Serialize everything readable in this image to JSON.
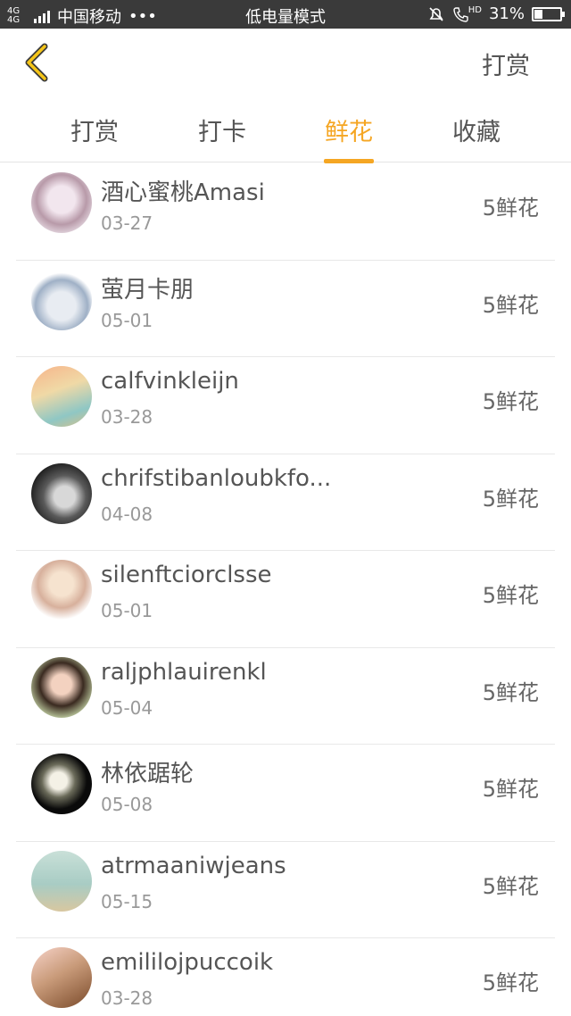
{
  "status_bar": {
    "network": "4G 4G",
    "carrier": "中国移动",
    "dots": "•••",
    "mode": "低电量模式",
    "hd_label": "HD",
    "battery": "31%",
    "battery_level": 0.31
  },
  "header": {
    "action_label": "打赏"
  },
  "tabs": [
    {
      "label": "打赏"
    },
    {
      "label": "打卡"
    },
    {
      "label": "鲜花",
      "active": true
    },
    {
      "label": "收藏"
    }
  ],
  "list": [
    {
      "name": "酒心蜜桃Amasi",
      "date": "03-27",
      "amount": "5鲜花"
    },
    {
      "name": "萤月卡朋",
      "date": "05-01",
      "amount": "5鲜花"
    },
    {
      "name": "calfvinkleijn",
      "date": "03-28",
      "amount": "5鲜花"
    },
    {
      "name": "chrifstibanloubkfo...",
      "date": "04-08",
      "amount": "5鲜花"
    },
    {
      "name": "silenftciorclsse",
      "date": "05-01",
      "amount": "5鲜花"
    },
    {
      "name": "raljphlauirenkl",
      "date": "05-04",
      "amount": "5鲜花"
    },
    {
      "name": "林依踞轮",
      "date": "05-08",
      "amount": "5鲜花"
    },
    {
      "name": "atrmaaniwjeans",
      "date": "05-15",
      "amount": "5鲜花"
    },
    {
      "name": "emililojpuccoik",
      "date": "03-28",
      "amount": "5鲜花"
    }
  ],
  "colors": {
    "accent": "#f5a623",
    "status_bar": "#3a3a3a"
  }
}
